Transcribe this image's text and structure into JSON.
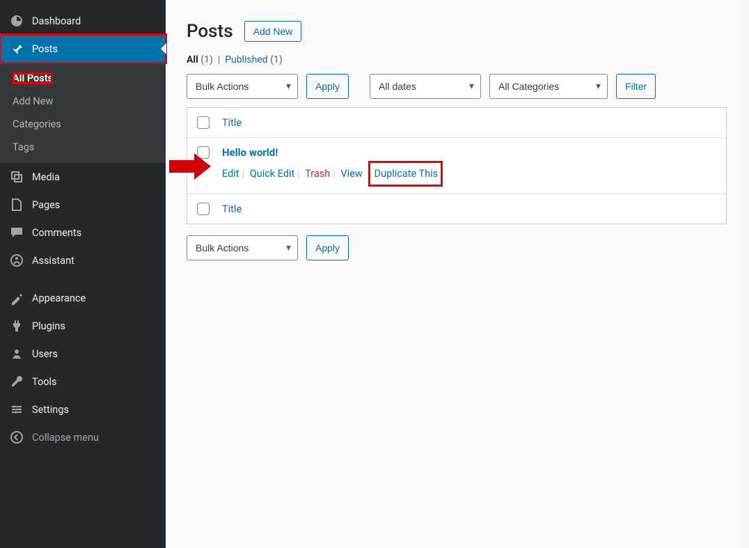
{
  "sidebar": {
    "dashboard": "Dashboard",
    "posts": "Posts",
    "submenu": {
      "all_posts": "All Posts",
      "add_new": "Add New",
      "categories": "Categories",
      "tags": "Tags"
    },
    "media": "Media",
    "pages": "Pages",
    "comments": "Comments",
    "assistant": "Assistant",
    "appearance": "Appearance",
    "plugins": "Plugins",
    "users": "Users",
    "tools": "Tools",
    "settings": "Settings",
    "collapse": "Collapse menu"
  },
  "page": {
    "title": "Posts",
    "add_new": "Add New"
  },
  "subsub": {
    "all_label": "All",
    "all_count": "(1)",
    "sep": "|",
    "published_label": "Published",
    "published_count": "(1)"
  },
  "filters": {
    "bulk_actions": "Bulk Actions",
    "apply": "Apply",
    "all_dates": "All dates",
    "all_categories": "All Categories",
    "filter": "Filter"
  },
  "table": {
    "col_title": "Title",
    "post_title": "Hello world!",
    "actions": {
      "edit": "Edit",
      "quick_edit": "Quick Edit",
      "trash": "Trash",
      "view": "View",
      "duplicate": "Duplicate This"
    }
  }
}
